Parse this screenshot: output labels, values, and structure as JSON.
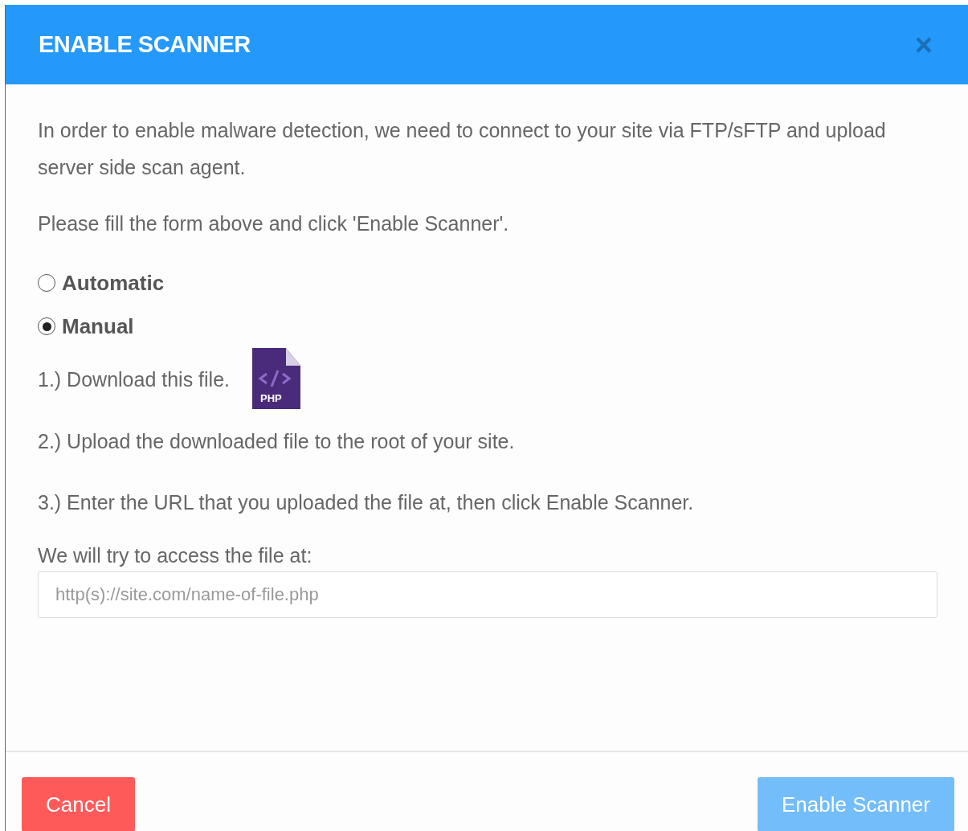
{
  "dialog": {
    "title": "ENABLE SCANNER",
    "close": "×"
  },
  "intro": "In order to enable malware detection, we need to connect to your site via FTP/sFTP and upload server side scan agent.",
  "instruction": "Please fill the form above and click 'Enable Scanner'.",
  "modes": [
    {
      "label": "Automatic",
      "selected": false
    },
    {
      "label": "Manual",
      "selected": true
    }
  ],
  "steps": [
    {
      "text": "1.) Download this file.",
      "file_icon_label": "PHP"
    },
    {
      "text": "2.) Upload the downloaded file to the root of your site."
    },
    {
      "text": "3.) Enter the URL that you uploaded the file at, then click Enable Scanner."
    }
  ],
  "url_field": {
    "label": "We will try to access the file at:",
    "placeholder": "http(s)://site.com/name-of-file.php"
  },
  "buttons": [
    {
      "kind": "cancel",
      "label": "Cancel",
      "disabled": false
    },
    {
      "kind": "primary",
      "label": "Enable Scanner",
      "disabled": true
    }
  ]
}
